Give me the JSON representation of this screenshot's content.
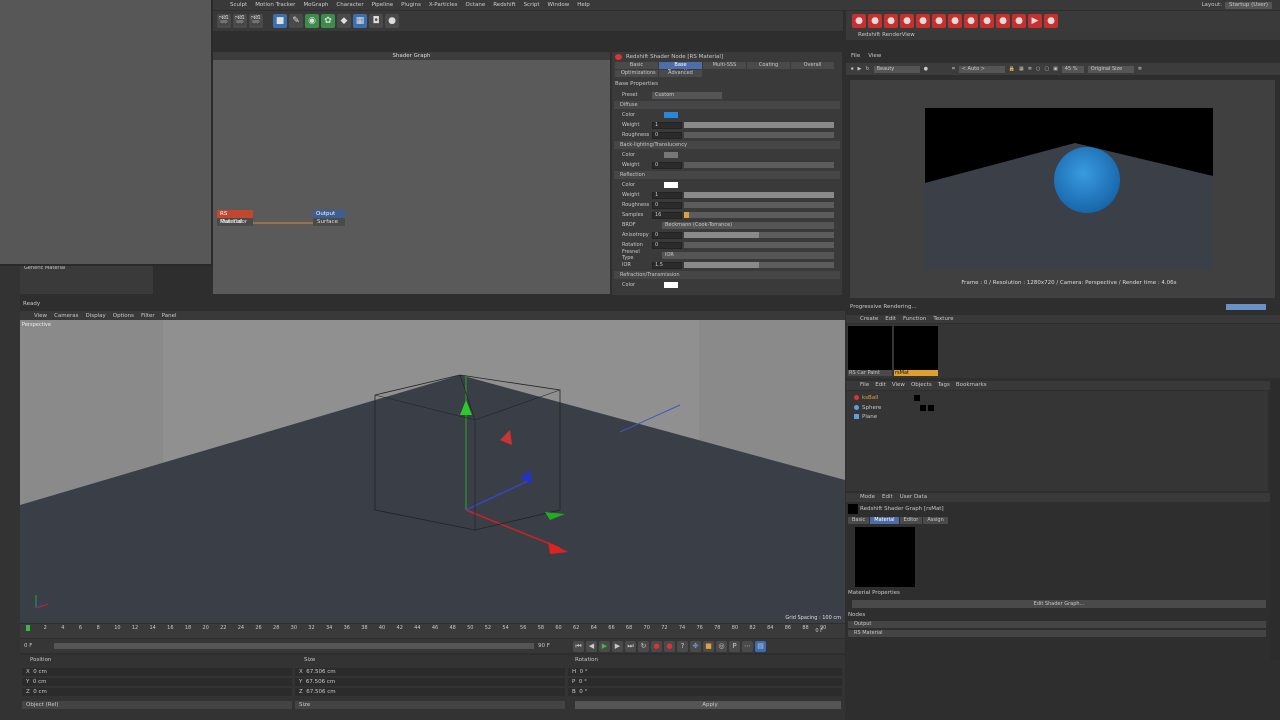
{
  "menubar": {
    "items": [
      "Sculpt",
      "Motion Tracker",
      "MoGraph",
      "Character",
      "Pipeline",
      "Plugins",
      "X-Particles",
      "Octane",
      "Redshift",
      "Script",
      "Window",
      "Help"
    ],
    "layout_label": "Layout:",
    "layout_value": "Startup (User)"
  },
  "shader_graph": {
    "title": "Shader Graph",
    "node_material": {
      "title": "RS Material",
      "port": "Out Color"
    },
    "node_output": {
      "title": "Output",
      "port": "Surface"
    }
  },
  "material_browser": {
    "item": "Generic Material"
  },
  "status": "Ready",
  "attr": {
    "title": "Redshift Shader Node [RS Material]",
    "tabs": [
      "Basic",
      "Base Properties",
      "Multi-SSS",
      "Coating",
      "Overall",
      "Optimizations",
      "Advanced"
    ],
    "active_tab": "Base Properties",
    "base_properties": "Base Properties",
    "preset_label": "Preset",
    "preset_value": "Custom",
    "diffuse": {
      "header": "Diffuse",
      "color_label": "Color",
      "color": "#2a86d8",
      "weight_label": "Weight",
      "weight": "1",
      "roughness_label": "Roughness",
      "roughness": "0"
    },
    "backlighting": {
      "header": "Back-lighting/Translucency",
      "color_label": "Color",
      "weight_label": "Weight",
      "weight": "0"
    },
    "reflection": {
      "header": "Reflection",
      "color_label": "Color",
      "weight_label": "Weight",
      "weight": "1",
      "roughness_label": "Roughness",
      "roughness": "0",
      "samples_label": "Samples",
      "samples": "16",
      "brdf_label": "BRDF",
      "brdf": "Beckmann (Cook-Torrance)",
      "anisotropy_label": "Anisotropy",
      "anisotropy": "0",
      "rotation_label": "Rotation",
      "rotation": "0",
      "fresnel_label": "Fresnel Type",
      "fresnel": "IOR",
      "ior_label": "IOR",
      "ior": "1.5"
    },
    "refraction": {
      "header": "Refraction/Transmission",
      "color_label": "Color"
    }
  },
  "viewport": {
    "menu": [
      "View",
      "Cameras",
      "Display",
      "Options",
      "Filter",
      "Panel"
    ],
    "label": "Perspective",
    "grid_spacing": "Grid Spacing : 100 cm"
  },
  "timeline": {
    "ticks": [
      "0",
      "2",
      "4",
      "6",
      "8",
      "10",
      "12",
      "14",
      "16",
      "18",
      "20",
      "22",
      "24",
      "26",
      "28",
      "30",
      "32",
      "34",
      "36",
      "38",
      "40",
      "42",
      "44",
      "46",
      "48",
      "50",
      "52",
      "54",
      "56",
      "58",
      "60",
      "62",
      "64",
      "66",
      "68",
      "70",
      "72",
      "74",
      "76",
      "78",
      "80",
      "82",
      "84",
      "86",
      "88",
      "90"
    ],
    "current": "0 F",
    "start": "0 F",
    "end": "90 F",
    "end2": "90 F",
    "playhead_fraction": 0.0
  },
  "coords": {
    "headers": {
      "position": "Position",
      "size": "Size",
      "rotation": "Rotation"
    },
    "rows": [
      {
        "axis": "X",
        "pos": "0 cm",
        "size": "67.506 cm",
        "rotlabel": "H",
        "rot": "0 °"
      },
      {
        "axis": "Y",
        "pos": "0 cm",
        "size": "67.506 cm",
        "rotlabel": "P",
        "rot": "0 °"
      },
      {
        "axis": "Z",
        "pos": "0 cm",
        "size": "67.506 cm",
        "rotlabel": "B",
        "rot": "0 °"
      }
    ],
    "mode": "Object (Rel)",
    "size_mode": "Size",
    "apply": "Apply"
  },
  "renderview": {
    "title": "Redshift RenderView",
    "menu": [
      "File",
      "View"
    ],
    "beauty": "Beauty",
    "auto": "< Auto >",
    "zoom": "45 %",
    "size": "Original Size",
    "info": "Frame : 0  /  Resolution : 1280x720  /  Camera: Perspective  /  Render time : 4.06s",
    "progress": "Progressive Rendering..."
  },
  "material_manager": {
    "menu": [
      "Create",
      "Edit",
      "Function",
      "Texture"
    ],
    "materials": [
      {
        "name": "RS Car Paint"
      },
      {
        "name": "rsMat"
      }
    ]
  },
  "object_manager": {
    "menu": [
      "File",
      "Edit",
      "View",
      "Objects",
      "Tags",
      "Bookmarks"
    ],
    "objects": [
      {
        "name": "ksBall",
        "color": "#e3a23c"
      },
      {
        "name": "Sphere",
        "color": "#cfcfcf"
      },
      {
        "name": "Plane",
        "color": "#cfcfcf"
      }
    ]
  },
  "attr_manager": {
    "menu": [
      "Mode",
      "Edit",
      "User Data"
    ],
    "title": "Redshift Shader Graph [rsMat]",
    "tabs": [
      "Basic",
      "Material",
      "Editor",
      "Assign"
    ],
    "active_tab": "Material",
    "mat_props": "Material Properties",
    "edit_button": "Edit Shader Graph...",
    "nodes_label": "Nodes",
    "nodes": [
      "Output",
      "RS Material"
    ]
  }
}
